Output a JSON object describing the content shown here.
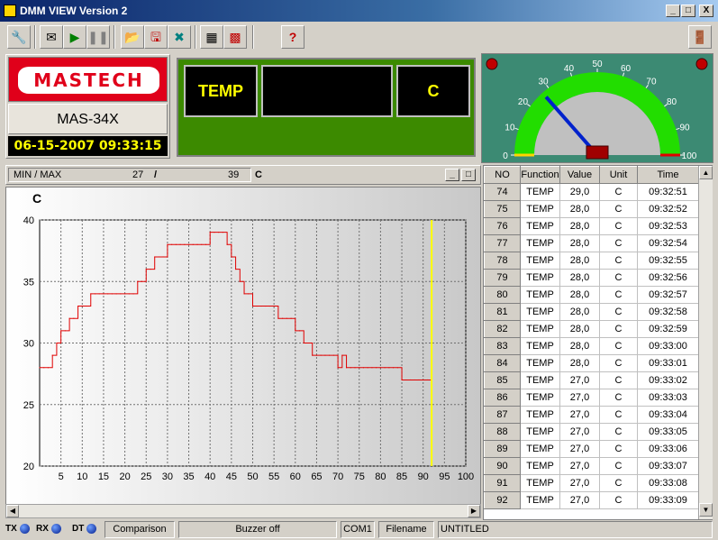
{
  "window": {
    "title": "DMM VIEW Version 2"
  },
  "caption_buttons": {
    "minimize": "_",
    "maximize": "□",
    "close": "X"
  },
  "brand": {
    "logo": "MASTECH",
    "model": "MAS-34X",
    "datetime": "06-15-2007 09:33:15"
  },
  "display": {
    "function": "TEMP",
    "value": "",
    "unit": "C"
  },
  "gauge": {
    "ticks": [
      "0",
      "10",
      "20",
      "30",
      "40",
      "50",
      "60",
      "70",
      "80",
      "90",
      "100"
    ],
    "needle_value": 27
  },
  "chart_header": {
    "label": "MIN / MAX",
    "min": "27",
    "sep": "/",
    "max": "39",
    "unit": "C"
  },
  "chart_data": {
    "type": "line",
    "title": "C",
    "xlabel": "",
    "ylabel": "",
    "xlim": [
      0,
      100
    ],
    "ylim": [
      20,
      40
    ],
    "x_ticks": [
      "5",
      "10",
      "15",
      "20",
      "25",
      "30",
      "35",
      "40",
      "45",
      "50",
      "55",
      "60",
      "65",
      "70",
      "75",
      "80",
      "85",
      "90",
      "95",
      "100"
    ],
    "y_ticks": [
      "20",
      "25",
      "30",
      "35",
      "40"
    ],
    "grid": true,
    "cursor_x": 92,
    "x": [
      0,
      1,
      2,
      3,
      4,
      5,
      6,
      7,
      8,
      9,
      10,
      11,
      12,
      13,
      14,
      15,
      16,
      17,
      18,
      19,
      20,
      21,
      22,
      23,
      24,
      25,
      26,
      27,
      28,
      29,
      30,
      31,
      32,
      33,
      34,
      35,
      36,
      37,
      38,
      39,
      40,
      41,
      42,
      43,
      44,
      45,
      46,
      47,
      48,
      49,
      50,
      51,
      52,
      53,
      54,
      55,
      56,
      57,
      58,
      59,
      60,
      61,
      62,
      63,
      64,
      65,
      66,
      67,
      68,
      69,
      70,
      71,
      72,
      73,
      74,
      75,
      76,
      77,
      78,
      79,
      80,
      81,
      82,
      83,
      84,
      85,
      86,
      87,
      88,
      89,
      90,
      91,
      92
    ],
    "series": [
      {
        "values": [
          28,
          28,
          28,
          29,
          30,
          31,
          31,
          32,
          32,
          33,
          33,
          33,
          34,
          34,
          34,
          34,
          34,
          34,
          34,
          34,
          34,
          34,
          34,
          35,
          35,
          36,
          36,
          37,
          37,
          37,
          38,
          38,
          38,
          38,
          38,
          38,
          38,
          38,
          38,
          38,
          39,
          39,
          39,
          39,
          38,
          37,
          36,
          35,
          34,
          34,
          33,
          33,
          33,
          33,
          33,
          33,
          32,
          32,
          32,
          32,
          31,
          31,
          30,
          30,
          29,
          29,
          29,
          29,
          29,
          29,
          28,
          29,
          28,
          28,
          28,
          28,
          28,
          28,
          28,
          28,
          28,
          28,
          28,
          28,
          28,
          27,
          27,
          27,
          27,
          27,
          27,
          27,
          27
        ]
      }
    ]
  },
  "table": {
    "columns": [
      "NO",
      "Function",
      "Value",
      "Unit",
      "Time"
    ],
    "rows": [
      [
        "74",
        "TEMP",
        "29,0",
        "C",
        "09:32:51"
      ],
      [
        "75",
        "TEMP",
        "28,0",
        "C",
        "09:32:52"
      ],
      [
        "76",
        "TEMP",
        "28,0",
        "C",
        "09:32:53"
      ],
      [
        "77",
        "TEMP",
        "28,0",
        "C",
        "09:32:54"
      ],
      [
        "78",
        "TEMP",
        "28,0",
        "C",
        "09:32:55"
      ],
      [
        "79",
        "TEMP",
        "28,0",
        "C",
        "09:32:56"
      ],
      [
        "80",
        "TEMP",
        "28,0",
        "C",
        "09:32:57"
      ],
      [
        "81",
        "TEMP",
        "28,0",
        "C",
        "09:32:58"
      ],
      [
        "82",
        "TEMP",
        "28,0",
        "C",
        "09:32:59"
      ],
      [
        "83",
        "TEMP",
        "28,0",
        "C",
        "09:33:00"
      ],
      [
        "84",
        "TEMP",
        "28,0",
        "C",
        "09:33:01"
      ],
      [
        "85",
        "TEMP",
        "27,0",
        "C",
        "09:33:02"
      ],
      [
        "86",
        "TEMP",
        "27,0",
        "C",
        "09:33:03"
      ],
      [
        "87",
        "TEMP",
        "27,0",
        "C",
        "09:33:04"
      ],
      [
        "88",
        "TEMP",
        "27,0",
        "C",
        "09:33:05"
      ],
      [
        "89",
        "TEMP",
        "27,0",
        "C",
        "09:33:06"
      ],
      [
        "90",
        "TEMP",
        "27,0",
        "C",
        "09:33:07"
      ],
      [
        "91",
        "TEMP",
        "27,0",
        "C",
        "09:33:08"
      ],
      [
        "92",
        "TEMP",
        "27,0",
        "C",
        "09:33:09"
      ]
    ]
  },
  "status": {
    "tx": "TX",
    "rx": "RX",
    "dt": "DT",
    "comparison": "Comparison",
    "buzzer": "Buzzer off",
    "port": "COM1",
    "filename_label": "Filename",
    "filename": "UNTITLED"
  },
  "colors": {
    "chart_line": "#e00000",
    "cursor": "#ffff00",
    "display_text": "#ffff00",
    "gauge_arc": "#22dd00"
  }
}
